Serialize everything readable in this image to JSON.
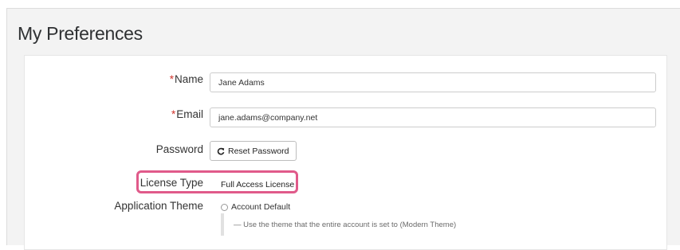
{
  "header": {
    "title": "My Preferences"
  },
  "form": {
    "name": {
      "required_marker": "*",
      "label": "Name",
      "value": "Jane Adams"
    },
    "email": {
      "required_marker": "*",
      "label": "Email",
      "value": "jane.adams@company.net"
    },
    "password": {
      "label": "Password",
      "reset_button_label": "Reset Password",
      "reset_icon": "refresh-icon"
    },
    "license_type": {
      "label": "License Type",
      "value": "Full Access License",
      "highlight_color": "#e05a8a"
    },
    "application_theme": {
      "label": "Application Theme",
      "option_label": "Account Default",
      "option_description": "— Use the theme that the entire account is set to (Modern Theme)"
    }
  },
  "colors": {
    "required": "#d0342c",
    "background": "#f3f3f3",
    "card": "#ffffff"
  }
}
